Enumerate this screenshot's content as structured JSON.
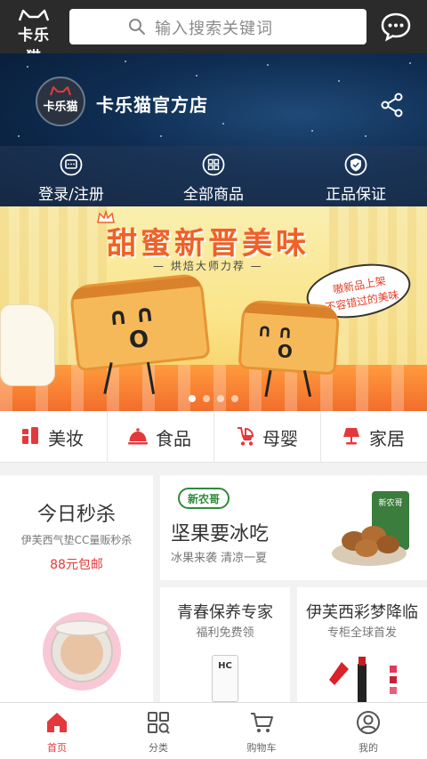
{
  "app": {
    "logo_text": "卡乐猫",
    "search_placeholder": "输入搜索关键词"
  },
  "store": {
    "name": "卡乐猫官方店",
    "avatar_text": "卡乐猫",
    "nav": [
      {
        "label": "登录/注册",
        "icon": "chat-square-icon"
      },
      {
        "label": "全部商品",
        "icon": "grid-icon"
      },
      {
        "label": "正品保证",
        "icon": "shield-icon"
      }
    ]
  },
  "banner": {
    "title": "甜蜜新晋美味",
    "subtitle": "— 烘焙大师力荐 —",
    "bubble_line1": "嗷新品上架",
    "bubble_line2": "不容错过的美味",
    "page_count": 4,
    "active_index": 0
  },
  "categories": [
    {
      "label": "美妆",
      "icon": "cosmetics-icon"
    },
    {
      "label": "食品",
      "icon": "food-cloche-icon"
    },
    {
      "label": "母婴",
      "icon": "stroller-icon"
    },
    {
      "label": "家居",
      "icon": "lamp-icon"
    }
  ],
  "promos": {
    "flash_sale": {
      "title": "今日秒杀",
      "desc": "伊芙西气垫CC量贩秒杀",
      "price": "88元包邮"
    },
    "nuts": {
      "brand": "新农哥",
      "title": "坚果要冰吃",
      "desc": "冰果来袭 清凉一夏",
      "package_brand": "新农哥"
    },
    "youth": {
      "title": "青春保养专家",
      "desc": "福利免费领",
      "product_label": "HC"
    },
    "lipstick": {
      "title": "伊芙西彩梦降临",
      "desc": "专柜全球首发"
    }
  },
  "tabbar": [
    {
      "label": "首页",
      "icon": "home-icon",
      "active": true
    },
    {
      "label": "分类",
      "icon": "category-icon",
      "active": false
    },
    {
      "label": "购物车",
      "icon": "cart-icon",
      "active": false
    },
    {
      "label": "我的",
      "icon": "profile-icon",
      "active": false
    }
  ],
  "colors": {
    "accent": "#e4393c",
    "topbar": "#2b2b2b",
    "store_bg": "#0f2d52",
    "banner_title": "#f0602a"
  }
}
